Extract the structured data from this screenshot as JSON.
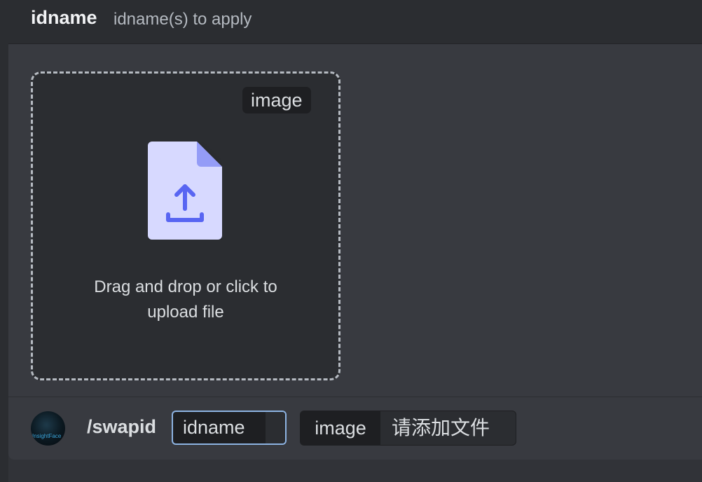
{
  "header": {
    "title": "idname",
    "description": "idname(s) to apply"
  },
  "upload": {
    "tag": "image",
    "text_line1": "Drag and drop or click to",
    "text_line2": "upload file",
    "icon": "file-upload-icon"
  },
  "composer": {
    "avatar_text": "InsightFace",
    "command": "/swapid",
    "options": [
      {
        "name": "idname",
        "value": ""
      },
      {
        "name": "image",
        "value": "请添加文件"
      }
    ]
  },
  "colors": {
    "accent": "#8db3e2",
    "file_icon_fill": "#d7d9ff",
    "file_icon_arrow": "#5865f2"
  }
}
